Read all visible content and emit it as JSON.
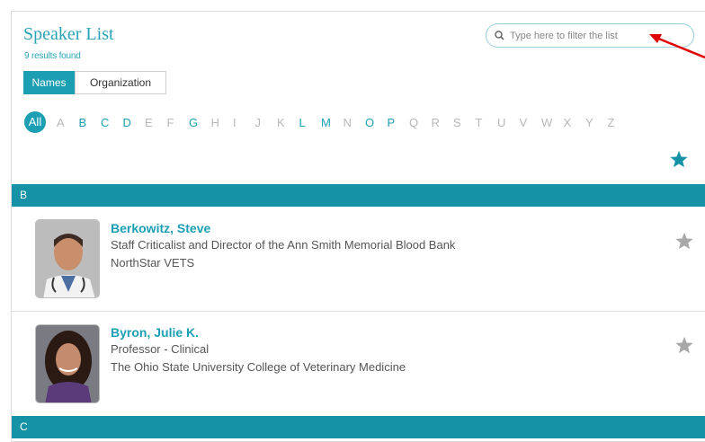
{
  "header": {
    "title": "Speaker List",
    "results": "9 results found"
  },
  "search": {
    "placeholder": "Type here to filter the list"
  },
  "toggle": {
    "names": "Names",
    "organization": "Organization"
  },
  "alphabet": {
    "all": "All",
    "letters": [
      {
        "l": "A",
        "on": false
      },
      {
        "l": "B",
        "on": true
      },
      {
        "l": "C",
        "on": true
      },
      {
        "l": "D",
        "on": true
      },
      {
        "l": "E",
        "on": false
      },
      {
        "l": "F",
        "on": false
      },
      {
        "l": "G",
        "on": true
      },
      {
        "l": "H",
        "on": false
      },
      {
        "l": "I",
        "on": false
      },
      {
        "l": "J",
        "on": false
      },
      {
        "l": "K",
        "on": false
      },
      {
        "l": "L",
        "on": true
      },
      {
        "l": "M",
        "on": true
      },
      {
        "l": "N",
        "on": false
      },
      {
        "l": "O",
        "on": true
      },
      {
        "l": "P",
        "on": true
      },
      {
        "l": "Q",
        "on": false
      },
      {
        "l": "R",
        "on": false
      },
      {
        "l": "S",
        "on": false
      },
      {
        "l": "T",
        "on": false
      },
      {
        "l": "U",
        "on": false
      },
      {
        "l": "V",
        "on": false
      },
      {
        "l": "W",
        "on": false
      },
      {
        "l": "X",
        "on": false
      },
      {
        "l": "Y",
        "on": false
      },
      {
        "l": "Z",
        "on": false
      }
    ]
  },
  "sections": [
    {
      "letter": "B",
      "speakers": [
        {
          "name": "Berkowitz, Steve",
          "title": "Staff Criticalist and Director of the Ann Smith Memorial Blood Bank",
          "org": "NorthStar VETS"
        },
        {
          "name": "Byron, Julie K.",
          "title": "Professor - Clinical",
          "org": "The Ohio State University College of Veterinary Medicine"
        }
      ]
    },
    {
      "letter": "C",
      "speakers": []
    }
  ],
  "colors": {
    "accent": "#1c9fb3",
    "band": "#1592a6",
    "star_inactive": "#a8a8a8",
    "arrow": "#e00000"
  }
}
